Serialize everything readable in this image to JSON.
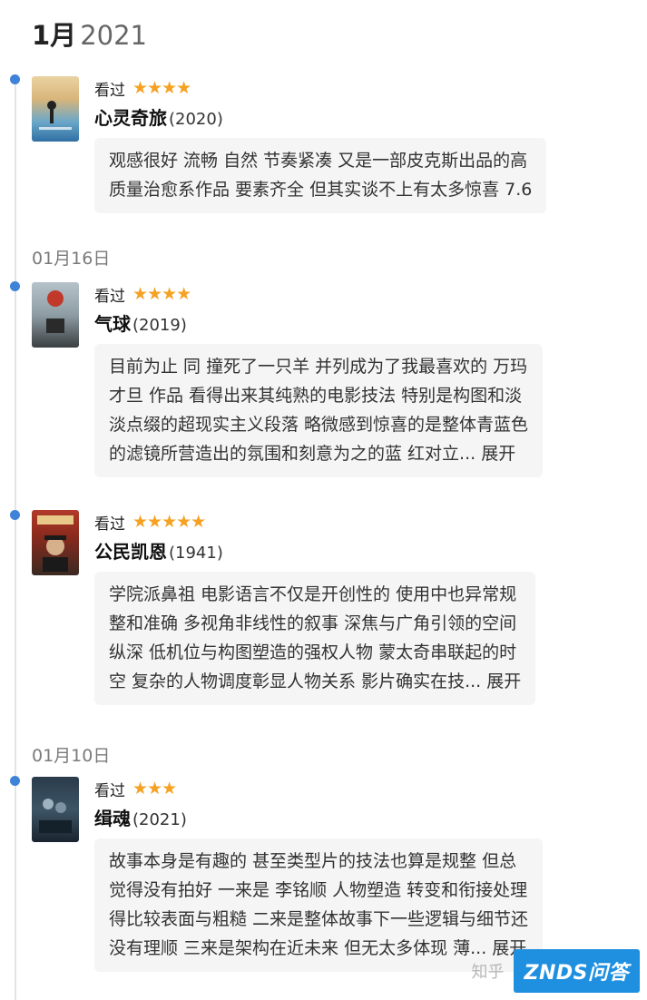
{
  "header": {
    "month": "1月",
    "year": "2021"
  },
  "date_labels": {
    "d1": "01月16日",
    "d2": "01月10日"
  },
  "entries": [
    {
      "status": "看过",
      "stars": "★★★★",
      "title": "心灵奇旅",
      "year": "(2020)",
      "comment": [
        "观感很好 流畅 自然 节奏紧凑 又是一部皮克斯出品的高",
        "质量治愈系作品 要素齐全 但其实谈不上有太多惊喜 7.6"
      ],
      "more": ""
    },
    {
      "status": "看过",
      "stars": "★★★★",
      "title": "气球",
      "year": "(2019)",
      "comment": [
        "目前为止 同 撞死了一只羊 并列成为了我最喜欢的 万玛",
        "才旦 作品 看得出来其纯熟的电影技法 特别是构图和淡",
        "淡点缀的超现实主义段落 略微感到惊喜的是整体青蓝色",
        "的滤镜所营造出的氛围和刻意为之的蓝 红对立..."
      ],
      "more": "展开"
    },
    {
      "status": "看过",
      "stars": "★★★★★",
      "title": "公民凯恩",
      "year": "(1941)",
      "comment": [
        "学院派鼻祖 电影语言不仅是开创性的 使用中也异常规",
        "整和准确 多视角非线性的叙事 深焦与广角引领的空间",
        "纵深 低机位与构图塑造的强权人物 蒙太奇串联起的时",
        "空 复杂的人物调度彰显人物关系 影片确实在技..."
      ],
      "more": "展开"
    },
    {
      "status": "看过",
      "stars": "★★★",
      "title": "缉魂",
      "year": "(2021)",
      "comment": [
        "故事本身是有趣的 甚至类型片的技法也算是规整 但总",
        "觉得没有拍好 一来是 李铭顺 人物塑造 转变和衔接处理",
        "得比较表面与粗糙 二来是整体故事下一些逻辑与细节还",
        "没有理顺 三来是架构在近未来 但无太多体现 薄..."
      ],
      "more": "展开"
    }
  ],
  "watermark": {
    "zhihu": "知乎",
    "badge": "ZNDS问答"
  }
}
